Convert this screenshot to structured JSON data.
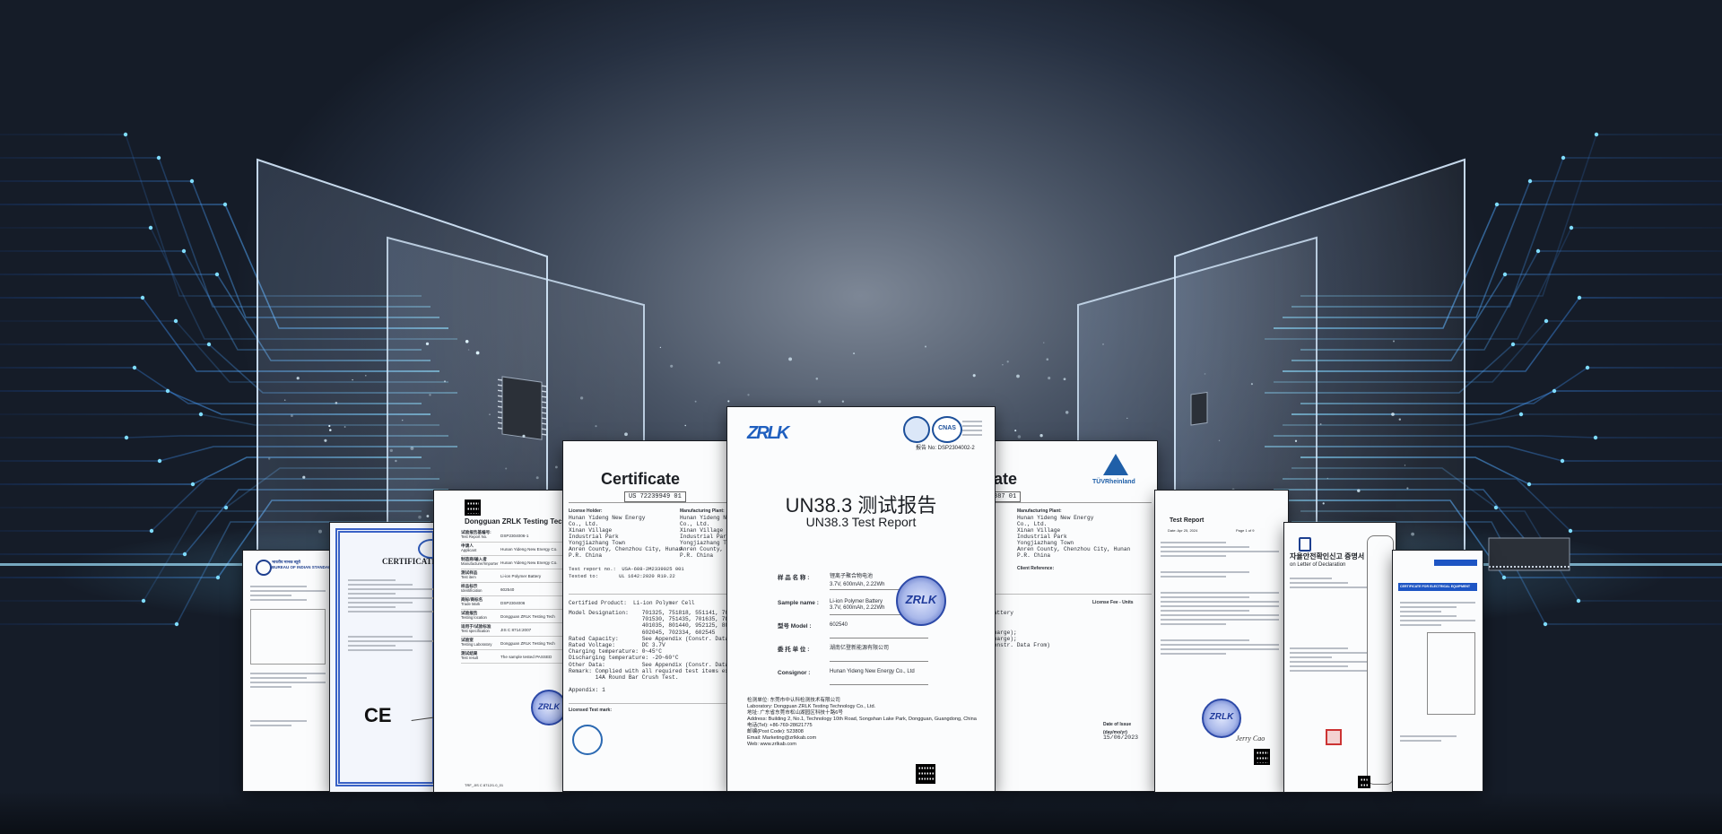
{
  "colors": {
    "accent_blue": "#2fa8ff",
    "seal_blue": "#2c49a8",
    "doc_white": "#fbfcfd",
    "tuv_blue": "#1f5fa8"
  },
  "main_report": {
    "report_no": "报告 No: DSP2304002-2",
    "title_cn": "UN38.3 测试报告",
    "title_en": "UN38.3 Test Report",
    "rows": [
      {
        "label": "样 品 名 称 :",
        "value_cn": "锂离子聚合物电池",
        "value_en": "3.7V, 600mAh, 2.22Wh"
      },
      {
        "label": "Sample name :",
        "value_en": "Li-ion Polymer Battery\n3.7V, 600mAh, 2.22Wh"
      },
      {
        "label": "型号 Model :",
        "value_en": "602540"
      },
      {
        "label": "委 托 单 位 :",
        "value_cn": "湖南亿登新能源有限公司"
      },
      {
        "label": "Consignor :",
        "value_en": "Hunan Yideng New Energy Co., Ltd"
      }
    ],
    "footer": "检测单位: 东莞市中认科检测技术有限公司\nLaboratory: Dongguan ZRLK Testing Technology Co., Ltd.\n地址: 广东省东莞市松山湖园区科技十路6号\nAddress: Building 2, No.1, Technology 10th Road, Songshan Lake Park, Dongguan, Guangdong, China\n电话(Tel): +86-769-28621775\n邮编(Post Code): 523808\nEmail: Marketing@zrlkkab.com\nWeb: www.zrlkab.com",
    "logo": "ZRLK",
    "seal_text": "ZRLK"
  },
  "ul_cert": {
    "title": "Certificate",
    "cert_no": "US 72239949 01",
    "holder_label": "License Holder:",
    "holder": "Hunan Yideng New Energy\nCo., Ltd.\nXinan Village\nIndustrial Park\nYongjiazhang Town\nAnren County, Chenzhou City, Hunan\nP.R. China",
    "plant_label": "Manufacturing Plant:",
    "plant": "Hunan Yideng New Energy\nCo., Ltd.\nXinan Village\nIndustrial Park\nYongjiazhang Town\nAnren County,\nP.R. China",
    "test_report": "Test report no.:  USA-608-2M2339025 001",
    "tested_to": "Tested to:       UL 1642:2020 R10.22",
    "product": "Certified Product:  Li-ion Polymer Cell",
    "specs": "Model Designation:    701325, 751818, 551141, 702030\n                      701530, 751435, 701635, 781435\n                      401035, 801440, 952125, 801045\n                      602045, 702334, 602545\nRated Capacity:       See Appendix (Constr. Data)\nRated Voltage:        DC 3.7V\nCharging temperature: 0~45°C\nDischarging temperature: -20~60°C\nOther Data:           See Appendix (Constr. Data)\nRemark: Complied with all required test items except\n        14A Round Bar Crush Test.\n\nAppendix: 1",
    "licensed_mark": "Licensed Test mark:"
  },
  "tuv_cert": {
    "title": "ate",
    "cert_no": "887 01",
    "brand": "TÜVRheinland",
    "plant": "Hunan Yideng New Energy\nCo., Ltd.\nXinan Village\nIndustrial Park\nYongjiazhang Town\nAnren County, Chenzhou City, Hunan\nP.R. China",
    "client_ref": "Client Reference:",
    "license_fee": "License Fee - Units",
    "lines": "Battery\n\n\nCharge);\nCharge);\nconstr. Data From)",
    "date_label": "Date of Issue\n(day/mo/yr)",
    "date": "15/06/2023"
  },
  "zrlk_report": {
    "header": "Dongguan ZRLK Testing Technology Co.",
    "labels": [
      "试验报告基编号:",
      "Test Report No.",
      "申请人",
      "Applicant",
      "制造商/输入者",
      "Manufacturer/Importer",
      "测试样品",
      "Test item",
      "样品标示",
      "Identification",
      "商标/商标名",
      "Trade Mark",
      "试验报告",
      "Testing location",
      "适用于/试验标准",
      "Test specification",
      "试验室",
      "Testing Laboratory",
      "测试结果",
      "Test result"
    ],
    "values": [
      "DSP2304006-1",
      "Hunan Yideng New Energy Co.",
      "Hunan Yideng New Energy Co.",
      "Li-ion Polymer Battery",
      "602540",
      "DSP2304006",
      "Dongguan ZRLK Testing Tech",
      "JIS C 8714:2007",
      "Dongguan ZRLK Testing Tech",
      "The sample tested PASSED"
    ],
    "footer": "TRF_JIS C 8712/1.0_01"
  },
  "bis_doc": {
    "header": "भारतीय मानक ब्यूरो\nBUREAU OF INDIAN STANDARDS"
  },
  "ce_cert": {
    "title": "CERTIFICATE OF",
    "ce_mark": "CE"
  },
  "test_report_right": {
    "title": "Test Report",
    "date": "Date: Apr 25, 2024",
    "page": "Page 1 of 9",
    "sign": "Jerry Cao"
  },
  "kc_cert": {
    "title": "자율안전확인신고 증명서",
    "subtitle": "on Letter of Declaration"
  },
  "small_cert": {
    "title": "CERTIFICATE FOR ELECTRICAL EQUIPMENT"
  }
}
